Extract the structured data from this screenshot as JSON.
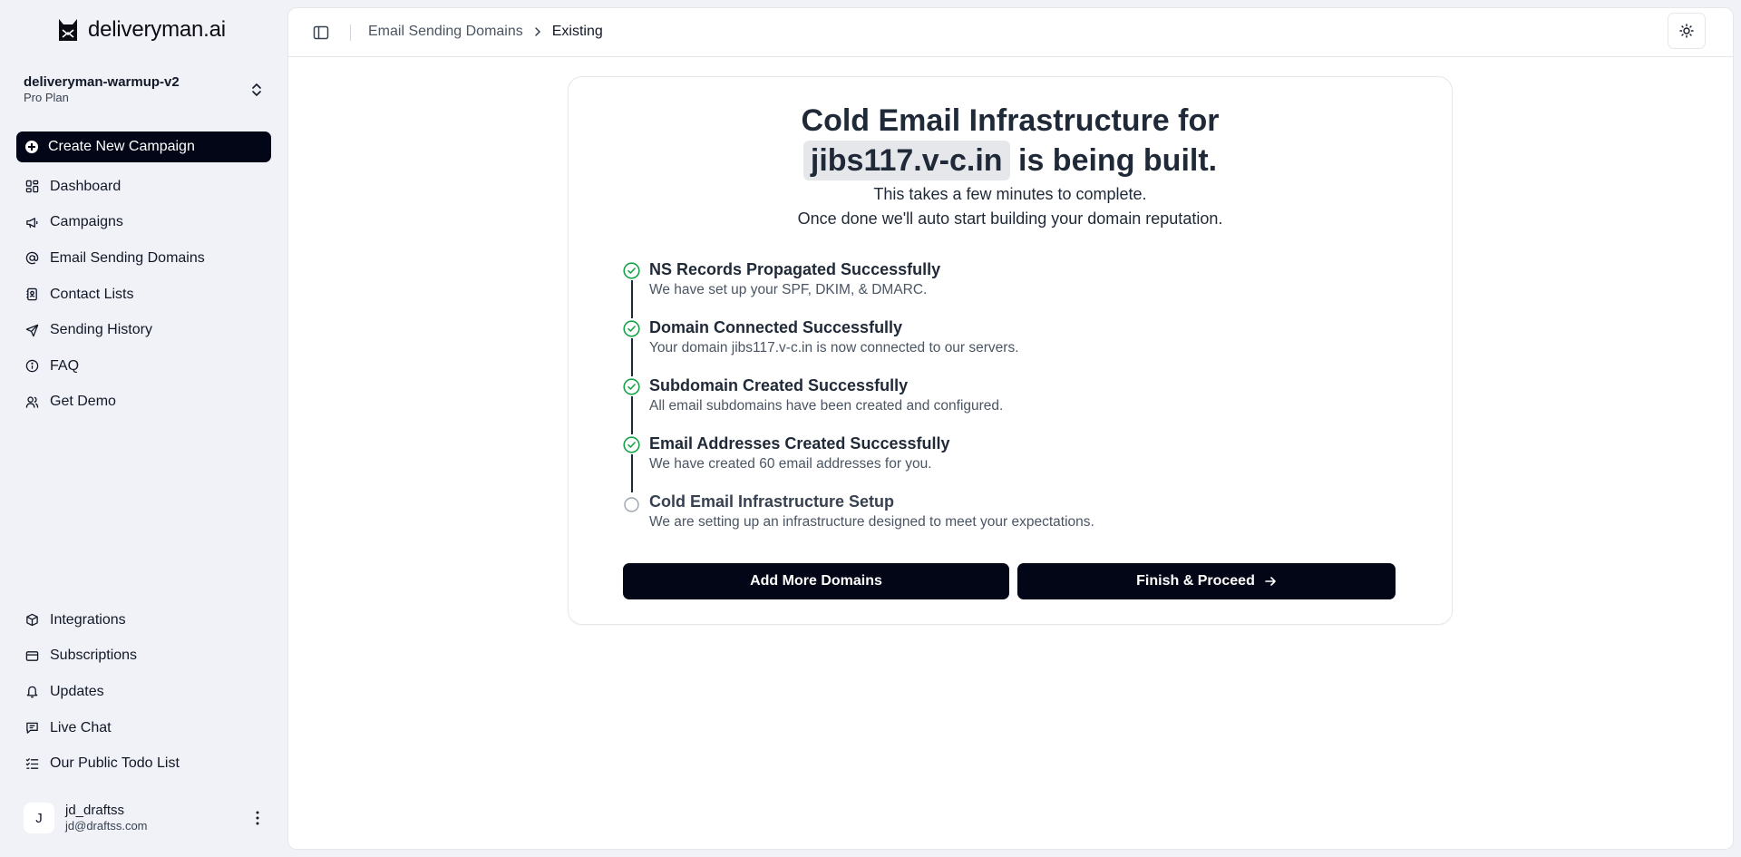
{
  "brand": {
    "name": "deliveryman.ai",
    "icon": "cat-logo-icon"
  },
  "workspace": {
    "name": "deliveryman-warmup-v2",
    "plan": "Pro Plan"
  },
  "sidebar": {
    "create_label": "Create New Campaign",
    "items": [
      {
        "label": "Dashboard",
        "icon": "dashboard-icon"
      },
      {
        "label": "Campaigns",
        "icon": "megaphone-icon"
      },
      {
        "label": "Email Sending Domains",
        "icon": "at-sign-icon"
      },
      {
        "label": "Contact Lists",
        "icon": "contact-book-icon"
      },
      {
        "label": "Sending History",
        "icon": "send-icon"
      },
      {
        "label": "FAQ",
        "icon": "info-icon"
      },
      {
        "label": "Get Demo",
        "icon": "users-icon"
      }
    ],
    "bottom_items": [
      {
        "label": "Integrations",
        "icon": "box-icon"
      },
      {
        "label": "Subscriptions",
        "icon": "credit-card-icon"
      },
      {
        "label": "Updates",
        "icon": "bell-icon"
      },
      {
        "label": "Live Chat",
        "icon": "chat-icon"
      },
      {
        "label": "Our Public Todo List",
        "icon": "list-checks-icon"
      }
    ]
  },
  "user": {
    "initial": "J",
    "name": "jd_draftss",
    "email": "jd@draftss.com"
  },
  "breadcrumb": {
    "parent": "Email Sending Domains",
    "current": "Existing"
  },
  "card": {
    "headline_line1": "Cold Email Infrastructure for",
    "domain": "jibs117.v-c.in",
    "headline_line2_suffix": "is being built.",
    "subtitle_line1": "This takes a few minutes to complete.",
    "subtitle_line2": "Once done we'll auto start building your domain reputation.",
    "steps": [
      {
        "title": "NS Records Propagated Successfully",
        "desc": "We have set up your SPF, DKIM, & DMARC.",
        "status": "done"
      },
      {
        "title": "Domain Connected Successfully",
        "desc": "Your domain jibs117.v-c.in is now connected to our servers.",
        "status": "done"
      },
      {
        "title": "Subdomain Created Successfully",
        "desc": "All email subdomains have been created and configured.",
        "status": "done"
      },
      {
        "title": "Email Addresses Created Successfully",
        "desc": "We have created 60 email addresses for you.",
        "status": "done"
      },
      {
        "title": "Cold Email Infrastructure Setup",
        "desc": "We are setting up an infrastructure designed to meet your expectations.",
        "status": "pending"
      }
    ],
    "add_more_label": "Add More Domains",
    "finish_label": "Finish & Proceed"
  },
  "colors": {
    "primary": "#020617",
    "success": "#16a34a",
    "background": "#f1f2f8"
  }
}
